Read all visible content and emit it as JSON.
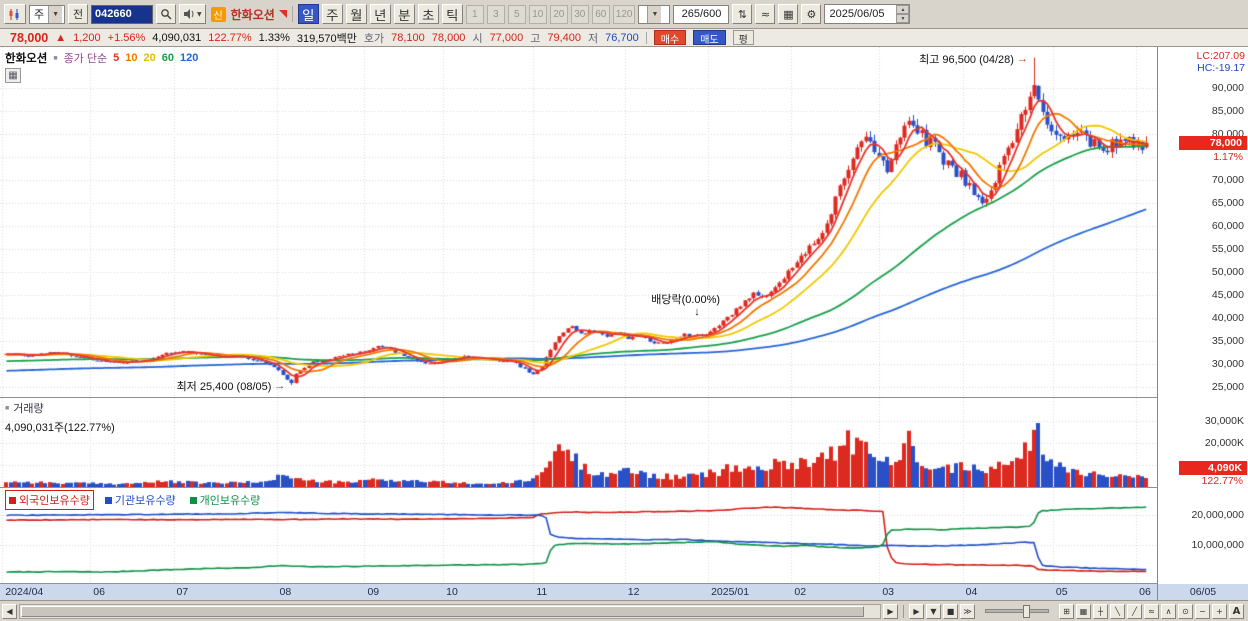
{
  "icons": {
    "chev": "▼",
    "spup": "▲",
    "spdn": "▼",
    "compare": "⇅",
    "linestyle": "≈",
    "save": "▦",
    "gear": "⚙",
    "grid": "▦",
    "win": "⊞",
    "cross": "┼",
    "tdown": "╲",
    "tup": "╱",
    "wave": "≈",
    "zig": "∧",
    "target": "⊙",
    "left": "◀",
    "right": "▶",
    "play": "▶",
    "down": "▼",
    "stop": "■",
    "ffwd": "≫",
    "minus": "−",
    "plus": "+",
    "autoA": "A",
    "sq": "■",
    "arrR": "→",
    "arrD": "↓"
  },
  "toolbar": {
    "stock_type": "주",
    "all_label": "전",
    "stock_code": "042660",
    "badge_new": "신",
    "stock_name": "한화오션",
    "period_buttons": [
      "일",
      "주",
      "월",
      "년",
      "분",
      "초",
      "틱"
    ],
    "selected_period": "일",
    "interval_buttons": [
      "1",
      "3",
      "5",
      "10",
      "20",
      "30",
      "60",
      "120"
    ],
    "candle_count": "265/600",
    "date": "2025/06/05"
  },
  "quote": {
    "price": "78,000",
    "change_dir": "▲",
    "change": "1,200",
    "change_pct": "+1.56%",
    "volume": "4,090,031",
    "volume_ratio": "122.77%",
    "turnover_pct": "1.33%",
    "value": "319,570백만",
    "hoga_label": "호가",
    "ask": "78,100",
    "bid": "78,000",
    "open_label": "시",
    "open": "77,000",
    "high_label": "고",
    "high": "79,400",
    "low_label": "저",
    "low": "76,700",
    "buy_label": "매수",
    "sell_label": "매도",
    "avg_label": "평"
  },
  "chart": {
    "legend_title": "한화오션",
    "legend_ma": "종가 단순",
    "ma_labels": [
      "5",
      "10",
      "20",
      "60",
      "120"
    ],
    "lc": "LC:207.09",
    "hc": "HC:-19.17",
    "annotation_high": "최고 96,500 (04/28)",
    "annotation_low": "최저 25,400 (08/05)",
    "annotation_div": "배당락(0.00%)",
    "price_badge": "78,000",
    "price_badge_pct": "1.17%",
    "y_labels": [
      "90,000",
      "85,000",
      "80,000",
      "70,000",
      "65,000",
      "60,000",
      "55,000",
      "50,000",
      "45,000",
      "40,000",
      "35,000",
      "30,000",
      "25,000"
    ]
  },
  "volume_panel": {
    "label": "거래량",
    "value_text": "4,090,031주(122.77%)",
    "y_labels": [
      "30,000K",
      "20,000K"
    ],
    "badge": "4,090K",
    "badge_pct": "122.77%"
  },
  "ownership_panel": {
    "legends": [
      {
        "label": "외국인보유수량",
        "color": "#d02018"
      },
      {
        "label": "기관보유수량",
        "color": "#2050c8"
      },
      {
        "label": "개인보유수량",
        "color": "#0f9048"
      }
    ],
    "y_labels": [
      "20,000,000",
      "10,000,000"
    ]
  },
  "x_axis": {
    "right_label": "06/05"
  },
  "chart_data": {
    "type": "candlestick",
    "title": "한화오션 (042660) 일봉 차트 2024/04 - 2025/06/05",
    "candles": 265,
    "up_color": "#dd2a20",
    "down_color": "#2a50c8",
    "price_axis": {
      "min": 22800,
      "max": 98800,
      "tick_min": 25000,
      "tick_max": 90000,
      "tick_step": 5000
    },
    "x_ticks": [
      {
        "label": "2024/04",
        "f": 0.002
      },
      {
        "label": "06",
        "f": 0.078
      },
      {
        "label": "07",
        "f": 0.15
      },
      {
        "label": "08",
        "f": 0.239
      },
      {
        "label": "09",
        "f": 0.315
      },
      {
        "label": "10",
        "f": 0.383
      },
      {
        "label": "11",
        "f": 0.461
      },
      {
        "label": "12",
        "f": 0.54
      },
      {
        "label": "2025/01",
        "f": 0.612
      },
      {
        "label": "02",
        "f": 0.684
      },
      {
        "label": "03",
        "f": 0.76
      },
      {
        "label": "04",
        "f": 0.832
      },
      {
        "label": "05",
        "f": 0.91
      },
      {
        "label": "06",
        "f": 0.982
      }
    ],
    "price_keypoints": [
      [
        0,
        32200
      ],
      [
        0.02,
        31800
      ],
      [
        0.04,
        32500
      ],
      [
        0.06,
        31500
      ],
      [
        0.08,
        30800
      ],
      [
        0.1,
        30300
      ],
      [
        0.12,
        30800
      ],
      [
        0.14,
        32300
      ],
      [
        0.16,
        32800
      ],
      [
        0.18,
        31500
      ],
      [
        0.2,
        31800
      ],
      [
        0.22,
        30800
      ],
      [
        0.235,
        29500
      ],
      [
        0.245,
        27000
      ],
      [
        0.25,
        26000
      ],
      [
        0.255,
        28500
      ],
      [
        0.27,
        30500
      ],
      [
        0.29,
        31500
      ],
      [
        0.31,
        32500
      ],
      [
        0.325,
        33800
      ],
      [
        0.34,
        32800
      ],
      [
        0.355,
        31000
      ],
      [
        0.37,
        29800
      ],
      [
        0.385,
        30800
      ],
      [
        0.4,
        31800
      ],
      [
        0.415,
        31300
      ],
      [
        0.43,
        30800
      ],
      [
        0.445,
        30300
      ],
      [
        0.455,
        28800
      ],
      [
        0.462,
        27800
      ],
      [
        0.468,
        28800
      ],
      [
        0.474,
        31500
      ],
      [
        0.48,
        34500
      ],
      [
        0.487,
        36800
      ],
      [
        0.495,
        38200
      ],
      [
        0.505,
        36500
      ],
      [
        0.515,
        37300
      ],
      [
        0.525,
        36000
      ],
      [
        0.535,
        36800
      ],
      [
        0.545,
        35500
      ],
      [
        0.555,
        36300
      ],
      [
        0.565,
        34800
      ],
      [
        0.575,
        34300
      ],
      [
        0.585,
        35300
      ],
      [
        0.595,
        36300
      ],
      [
        0.605,
        36000
      ],
      [
        0.615,
        36800
      ],
      [
        0.625,
        38500
      ],
      [
        0.635,
        40500
      ],
      [
        0.645,
        43000
      ],
      [
        0.655,
        45500
      ],
      [
        0.665,
        44500
      ],
      [
        0.675,
        47000
      ],
      [
        0.685,
        49500
      ],
      [
        0.695,
        52500
      ],
      [
        0.705,
        55500
      ],
      [
        0.715,
        58500
      ],
      [
        0.722,
        62000
      ],
      [
        0.729,
        67000
      ],
      [
        0.737,
        72500
      ],
      [
        0.745,
        77000
      ],
      [
        0.752,
        80000
      ],
      [
        0.758,
        78000
      ],
      [
        0.765,
        75000
      ],
      [
        0.772,
        72500
      ],
      [
        0.779,
        76500
      ],
      [
        0.786,
        79500
      ],
      [
        0.793,
        83500
      ],
      [
        0.8,
        80500
      ],
      [
        0.807,
        78500
      ],
      [
        0.814,
        77000
      ],
      [
        0.821,
        74500
      ],
      [
        0.828,
        72500
      ],
      [
        0.835,
        71500
      ],
      [
        0.842,
        69500
      ],
      [
        0.85,
        66500
      ],
      [
        0.857,
        64500
      ],
      [
        0.864,
        68000
      ],
      [
        0.871,
        72000
      ],
      [
        0.878,
        76500
      ],
      [
        0.885,
        80500
      ],
      [
        0.892,
        85500
      ],
      [
        0.898,
        90000
      ],
      [
        0.902,
        92000
      ],
      [
        0.908,
        86500
      ],
      [
        0.914,
        82500
      ],
      [
        0.92,
        80500
      ],
      [
        0.928,
        80000
      ],
      [
        0.936,
        79000
      ],
      [
        0.944,
        79500
      ],
      [
        0.952,
        78000
      ],
      [
        0.96,
        76500
      ],
      [
        0.968,
        77500
      ],
      [
        0.976,
        78500
      ],
      [
        0.984,
        77800
      ],
      [
        0.992,
        77500
      ],
      [
        1,
        78000
      ]
    ],
    "high_point": {
      "f": 0.901,
      "price": 96500,
      "date": "04/28"
    },
    "low_point": {
      "f": 0.25,
      "price": 25400,
      "date": "08/05"
    },
    "ex_dividend": {
      "f": 0.607
    },
    "last": {
      "open": 77000,
      "high": 79400,
      "low": 76700,
      "close": 78000
    },
    "ma_periods": [
      5,
      10,
      20,
      60,
      120
    ],
    "ma_colors": [
      "#e8342c",
      "#f07800",
      "#f0c800",
      "#18a048",
      "#2565d6"
    ],
    "ma_pad": [
      0.998,
      0.995,
      0.99,
      0.95,
      0.885
    ],
    "volume_axis": {
      "max_k": 40500,
      "ticks_k": [
        30000,
        20000,
        10000
      ]
    },
    "volume_keypoints_k": [
      [
        0,
        2500
      ],
      [
        0.05,
        1800
      ],
      [
        0.1,
        1500
      ],
      [
        0.14,
        2500
      ],
      [
        0.18,
        1800
      ],
      [
        0.22,
        2200
      ],
      [
        0.245,
        5500
      ],
      [
        0.26,
        3000
      ],
      [
        0.3,
        2000
      ],
      [
        0.325,
        3500
      ],
      [
        0.37,
        2500
      ],
      [
        0.4,
        1800
      ],
      [
        0.43,
        1500
      ],
      [
        0.46,
        3000
      ],
      [
        0.474,
        9000
      ],
      [
        0.482,
        16000
      ],
      [
        0.49,
        19000
      ],
      [
        0.5,
        12000
      ],
      [
        0.51,
        8000
      ],
      [
        0.53,
        6000
      ],
      [
        0.55,
        7500
      ],
      [
        0.57,
        5000
      ],
      [
        0.59,
        4500
      ],
      [
        0.61,
        5500
      ],
      [
        0.625,
        7000
      ],
      [
        0.64,
        9000
      ],
      [
        0.655,
        8000
      ],
      [
        0.67,
        9500
      ],
      [
        0.685,
        11000
      ],
      [
        0.7,
        12000
      ],
      [
        0.715,
        13500
      ],
      [
        0.73,
        17000
      ],
      [
        0.74,
        21000
      ],
      [
        0.75,
        18000
      ],
      [
        0.76,
        13000
      ],
      [
        0.772,
        12000
      ],
      [
        0.78,
        11000
      ],
      [
        0.793,
        22000
      ],
      [
        0.8,
        14000
      ],
      [
        0.81,
        11000
      ],
      [
        0.82,
        9500
      ],
      [
        0.83,
        8500
      ],
      [
        0.84,
        9000
      ],
      [
        0.85,
        11000
      ],
      [
        0.86,
        8500
      ],
      [
        0.87,
        9500
      ],
      [
        0.88,
        10500
      ],
      [
        0.892,
        14000
      ],
      [
        0.902,
        26000
      ],
      [
        0.905,
        31000
      ],
      [
        0.91,
        16000
      ],
      [
        0.92,
        11000
      ],
      [
        0.93,
        8500
      ],
      [
        0.94,
        7000
      ],
      [
        0.95,
        6000
      ],
      [
        0.96,
        6500
      ],
      [
        0.97,
        5500
      ],
      [
        0.98,
        5000
      ],
      [
        0.99,
        4500
      ],
      [
        1,
        4090
      ]
    ],
    "last_volume_k": 4090,
    "ownership_axis": {
      "unit": "millions_of_shares",
      "ticks_m": [
        20,
        10
      ]
    },
    "ownership_series": [
      {
        "name": "foreign",
        "color": "#d02018",
        "points": [
          [
            0,
            18.3
          ],
          [
            0.05,
            18.4
          ],
          [
            0.1,
            18.5
          ],
          [
            0.15,
            18.4
          ],
          [
            0.2,
            18.6
          ],
          [
            0.25,
            18.5
          ],
          [
            0.3,
            18.7
          ],
          [
            0.35,
            18.6
          ],
          [
            0.4,
            18.8
          ],
          [
            0.44,
            19.0
          ],
          [
            0.462,
            19.2
          ],
          [
            0.468,
            20.3
          ],
          [
            0.48,
            20.8
          ],
          [
            0.5,
            21.0
          ],
          [
            0.52,
            20.8
          ],
          [
            0.55,
            21.0
          ],
          [
            0.58,
            21.2
          ],
          [
            0.61,
            21.4
          ],
          [
            0.63,
            21.6
          ],
          [
            0.65,
            22.3
          ],
          [
            0.67,
            22.6
          ],
          [
            0.69,
            22.4
          ],
          [
            0.71,
            22.0
          ],
          [
            0.73,
            21.7
          ],
          [
            0.75,
            21.5
          ],
          [
            0.765,
            21.3
          ],
          [
            0.769,
            21.2
          ],
          [
            0.773,
            8.5
          ],
          [
            0.778,
            4.5
          ],
          [
            0.785,
            3.8
          ],
          [
            0.8,
            3.6
          ],
          [
            0.83,
            3.4
          ],
          [
            0.86,
            3.3
          ],
          [
            0.89,
            3.2
          ],
          [
            0.9,
            3.1
          ],
          [
            0.905,
            1.8
          ],
          [
            0.93,
            1.5
          ],
          [
            0.96,
            1.3
          ],
          [
            1,
            1.2
          ]
        ]
      },
      {
        "name": "institution",
        "color": "#2050c8",
        "points": [
          [
            0,
            19.9
          ],
          [
            0.05,
            20.0
          ],
          [
            0.1,
            20.1
          ],
          [
            0.15,
            20.3
          ],
          [
            0.2,
            20.4
          ],
          [
            0.24,
            20.9
          ],
          [
            0.27,
            20.6
          ],
          [
            0.3,
            20.4
          ],
          [
            0.35,
            20.3
          ],
          [
            0.4,
            20.1
          ],
          [
            0.44,
            20.0
          ],
          [
            0.46,
            19.9
          ],
          [
            0.473,
            19.8
          ],
          [
            0.477,
            13.5
          ],
          [
            0.485,
            12.5
          ],
          [
            0.5,
            12.2
          ],
          [
            0.53,
            12.0
          ],
          [
            0.56,
            11.7
          ],
          [
            0.59,
            11.9
          ],
          [
            0.62,
            11.4
          ],
          [
            0.65,
            11.0
          ],
          [
            0.68,
            10.7
          ],
          [
            0.71,
            10.4
          ],
          [
            0.74,
            10.0
          ],
          [
            0.76,
            9.7
          ],
          [
            0.78,
            9.9
          ],
          [
            0.8,
            9.6
          ],
          [
            0.83,
            9.8
          ],
          [
            0.86,
            10.2
          ],
          [
            0.88,
            10.6
          ],
          [
            0.895,
            10.9
          ],
          [
            0.902,
            10.8
          ],
          [
            0.907,
            3.2
          ],
          [
            0.93,
            2.6
          ],
          [
            0.96,
            2.2
          ],
          [
            1,
            1.8
          ]
        ]
      },
      {
        "name": "individual",
        "color": "#0f9048",
        "points": [
          [
            0,
            1.0
          ],
          [
            0.05,
            1.1
          ],
          [
            0.09,
            1.0
          ],
          [
            0.13,
            1.6
          ],
          [
            0.17,
            2.1
          ],
          [
            0.21,
            2.4
          ],
          [
            0.24,
            3.1
          ],
          [
            0.27,
            2.7
          ],
          [
            0.31,
            2.9
          ],
          [
            0.35,
            3.1
          ],
          [
            0.39,
            3.3
          ],
          [
            0.43,
            3.4
          ],
          [
            0.46,
            3.6
          ],
          [
            0.473,
            3.8
          ],
          [
            0.479,
            9.8
          ],
          [
            0.49,
            10.3
          ],
          [
            0.51,
            10.6
          ],
          [
            0.54,
            10.3
          ],
          [
            0.57,
            10.6
          ],
          [
            0.6,
            10.9
          ],
          [
            0.62,
            11.2
          ],
          [
            0.64,
            10.4
          ],
          [
            0.66,
            9.9
          ],
          [
            0.68,
            9.6
          ],
          [
            0.7,
            9.9
          ],
          [
            0.72,
            9.3
          ],
          [
            0.74,
            9.0
          ],
          [
            0.755,
            9.2
          ],
          [
            0.768,
            9.4
          ],
          [
            0.774,
            14.8
          ],
          [
            0.79,
            15.3
          ],
          [
            0.82,
            15.1
          ],
          [
            0.85,
            15.6
          ],
          [
            0.88,
            15.9
          ],
          [
            0.9,
            16.2
          ],
          [
            0.906,
            21.3
          ],
          [
            0.93,
            21.9
          ],
          [
            0.96,
            22.2
          ],
          [
            0.98,
            22.4
          ],
          [
            1,
            22.6
          ]
        ]
      }
    ]
  }
}
